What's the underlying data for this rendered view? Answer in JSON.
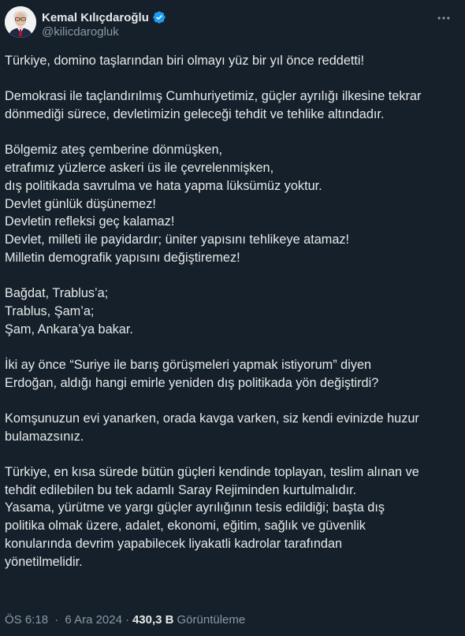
{
  "author": {
    "display_name": "Kemal Kılıçdaroğlu",
    "handle": "@kilicdarogluk",
    "verified": true
  },
  "icons": {
    "verified": "verified-badge-icon",
    "more": "more-horizontal-icon"
  },
  "colors": {
    "background": "#15202b",
    "text": "#e7e9ea",
    "secondary_text": "#8b98a5",
    "verified_badge": "#1d9bf0"
  },
  "tweet": {
    "paragraphs": [
      [
        "Türkiye, domino taşlarından biri olmayı yüz bir yıl önce reddetti!"
      ],
      [
        "Demokrasi ile taçlandırılmış Cumhuriyetimiz, güçler ayrılığı ilkesine tekrar",
        "dönmediği sürece, devletimizin geleceği tehdit ve tehlike altındadır."
      ],
      [
        "Bölgemiz ateş çemberine dönmüşken,",
        "etrafımız yüzlerce askeri üs ile çevrelenmişken,",
        "dış politikada savrulma ve hata yapma lüksümüz yoktur.",
        "Devlet günlük düşünemez!",
        "Devletin refleksi geç kalamaz!",
        "Devlet, milleti ile payidardır; üniter yapısını tehlikeye atamaz!",
        "Milletin demografik yapısını değiştiremez!"
      ],
      [
        "Bağdat, Trablus’a;",
        "Trablus, Şam’a;",
        "Şam, Ankara’ya bakar."
      ],
      [
        "İki ay önce “Suriye ile barış görüşmeleri yapmak istiyorum” diyen",
        "Erdoğan, aldığı hangi emirle yeniden dış politikada yön değiştirdi?"
      ],
      [
        "Komşunuzun evi yanarken, orada kavga varken, siz kendi evinizde huzur",
        "bulamazsınız."
      ],
      [
        "Türkiye, en kısa sürede bütün güçleri kendinde toplayan, teslim alınan ve",
        "tehdit edilebilen bu tek adamlı Saray Rejiminden kurtulmalıdır.",
        "Yasama, yürütme ve yargı güçler ayrılığının tesis edildiği; başta dış",
        "politika olmak üzere, adalet, ekonomi, eğitim, sağlık ve güvenlik",
        "konularında devrim yapabilecek liyakatli kadrolar tarafından",
        "yönetilmelidir."
      ]
    ]
  },
  "meta": {
    "time": "ÖS 6:18",
    "separator": "·",
    "date": "6 Ara 2024",
    "views_count": "430,3 B",
    "views_label": "Görüntüleme"
  }
}
